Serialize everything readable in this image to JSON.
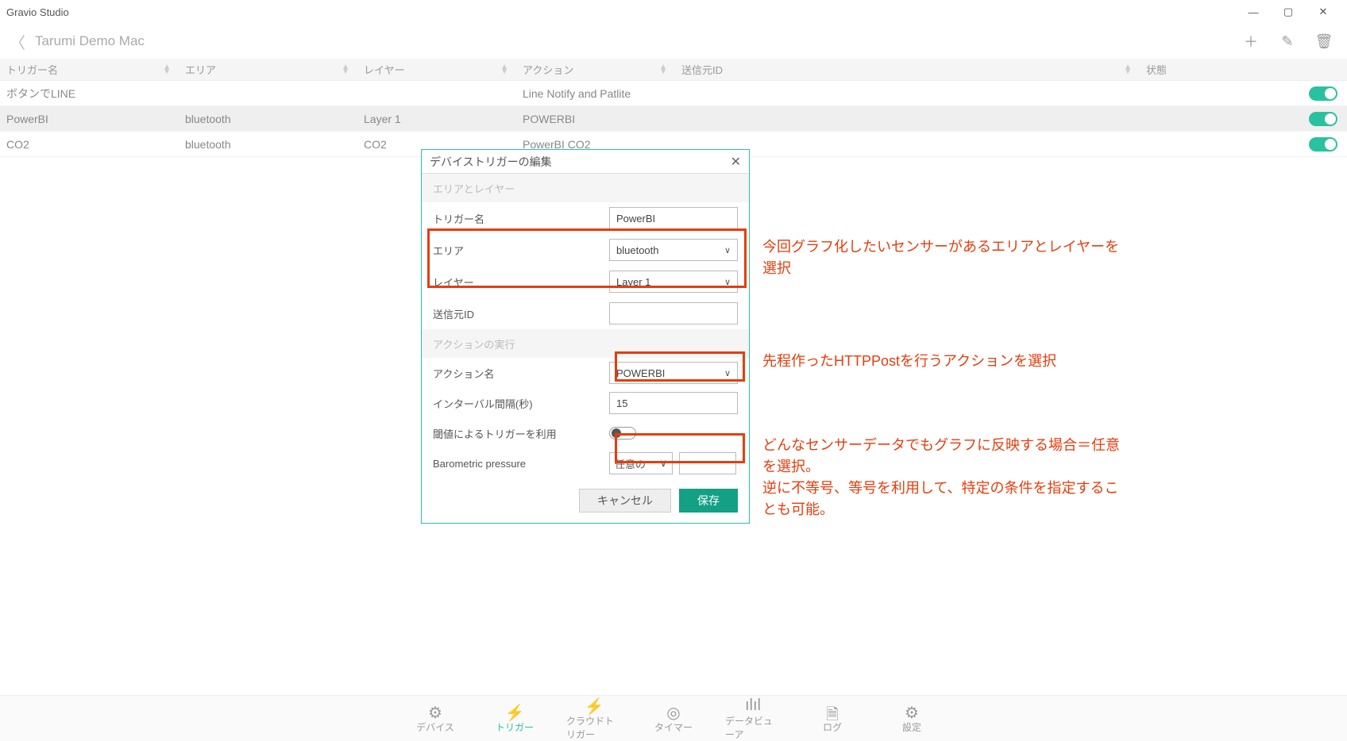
{
  "app": {
    "title": "Gravio Studio"
  },
  "breadcrumb": "Tarumi Demo Mac",
  "columns": {
    "trigger": "トリガー名",
    "area": "エリア",
    "layer": "レイヤー",
    "action": "アクション",
    "sender": "送信元ID",
    "state": "状態"
  },
  "rows": [
    {
      "trigger": "ボタンでLINE",
      "area": "",
      "layer": "",
      "action": "Line Notify and Patlite",
      "sender": "",
      "state": true
    },
    {
      "trigger": "PowerBI",
      "area": "bluetooth",
      "layer": "Layer 1",
      "action": "POWERBI",
      "sender": "",
      "state": true,
      "selected": true
    },
    {
      "trigger": "CO2",
      "area": "bluetooth",
      "layer": "CO2",
      "action": "PowerBI CO2",
      "sender": "",
      "state": true
    }
  ],
  "modal": {
    "title": "デバイストリガーの編集",
    "section1": "エリアとレイヤー",
    "section2": "アクションの実行",
    "labels": {
      "triggerName": "トリガー名",
      "area": "エリア",
      "layer": "レイヤー",
      "senderId": "送信元ID",
      "actionName": "アクション名",
      "interval": "インターバル間隔(秒)",
      "threshold": "閾値によるトリガーを利用",
      "barometric": "Barometric pressure"
    },
    "values": {
      "triggerName": "PowerBI",
      "area": "bluetooth",
      "layer": "Layer 1",
      "senderId": "",
      "actionName": "POWERBI",
      "interval": "15",
      "baromCondition": "任意の",
      "baromValue": ""
    },
    "buttons": {
      "cancel": "キャンセル",
      "save": "保存"
    }
  },
  "annotations": {
    "a1": "今回グラフ化したいセンサーがあるエリアとレイヤーを選択",
    "a2": "先程作ったHTTPPostを行うアクションを選択",
    "a3": "どんなセンサーデータでもグラフに反映する場合＝任意を選択。\n逆に不等号、等号を利用して、特定の条件を指定することも可能。"
  },
  "bottomNav": {
    "device": "デバイス",
    "trigger": "トリガー",
    "cloud": "クラウドトリガー",
    "timer": "タイマー",
    "data": "データビューア",
    "log": "ログ",
    "settings": "設定"
  }
}
